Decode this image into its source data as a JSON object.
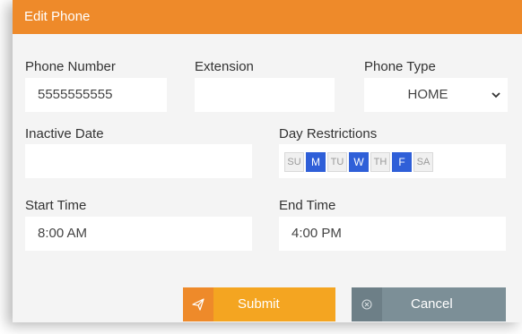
{
  "dialog": {
    "title": "Edit Phone",
    "fields": {
      "phone_number": {
        "label": "Phone Number",
        "value": "5555555555"
      },
      "extension": {
        "label": "Extension",
        "value": ""
      },
      "phone_type": {
        "label": "Phone Type",
        "value": "HOME"
      },
      "inactive_date": {
        "label": "Inactive Date",
        "value": ""
      },
      "day_restrictions": {
        "label": "Day Restrictions",
        "days": [
          {
            "label": "SU",
            "selected": false
          },
          {
            "label": "M",
            "selected": true
          },
          {
            "label": "TU",
            "selected": false
          },
          {
            "label": "W",
            "selected": true
          },
          {
            "label": "TH",
            "selected": false
          },
          {
            "label": "F",
            "selected": true
          },
          {
            "label": "SA",
            "selected": false
          }
        ]
      },
      "start_time": {
        "label": "Start Time",
        "value": "8:00 AM"
      },
      "end_time": {
        "label": "End Time",
        "value": "4:00 PM"
      }
    },
    "buttons": {
      "submit": {
        "label": "Submit",
        "icon": "send-icon"
      },
      "cancel": {
        "label": "Cancel",
        "icon": "cancel-circle-icon"
      }
    },
    "colors": {
      "header": "#ee8a2a",
      "submit": "#f4a521",
      "submit_icon_bg": "#ee8a2a",
      "cancel": "#7c8f97",
      "cancel_icon_bg": "#6d7f87",
      "day_selected": "#2f5fd8"
    }
  }
}
